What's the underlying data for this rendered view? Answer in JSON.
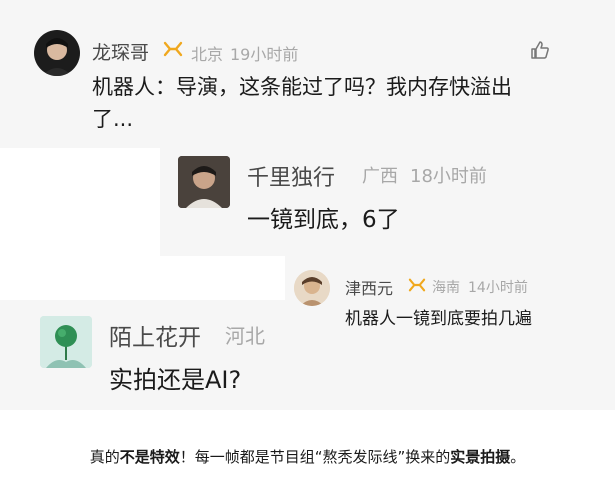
{
  "comments": [
    {
      "username": "龙琛哥",
      "location": "北京",
      "time": "19小时前",
      "text_line1": "机器人：导演，这条能过了吗？我内存快溢出",
      "text_line2": "了..."
    },
    {
      "username": "千里独行",
      "location": "广西",
      "time": "18小时前",
      "text": "一镜到底，6了"
    },
    {
      "username": "津西元",
      "location": "海南",
      "time": "14小时前",
      "text": "机器人一镜到底要拍几遍"
    },
    {
      "username": "陌上花开",
      "location": "河北",
      "text": "实拍还是AI?"
    }
  ],
  "caption": {
    "part1": "真的",
    "part2": "不是特效",
    "part3": "！每一帧都是节目组“熬秃发际线”换来的",
    "part4": "实景拍摄",
    "part5": "。"
  },
  "colors": {
    "badge": "#f0a81e",
    "panel": "#f6f6f6",
    "meta": "#a8a8a8"
  },
  "icons": [
    "like-icon",
    "vip-badge-icon"
  ]
}
